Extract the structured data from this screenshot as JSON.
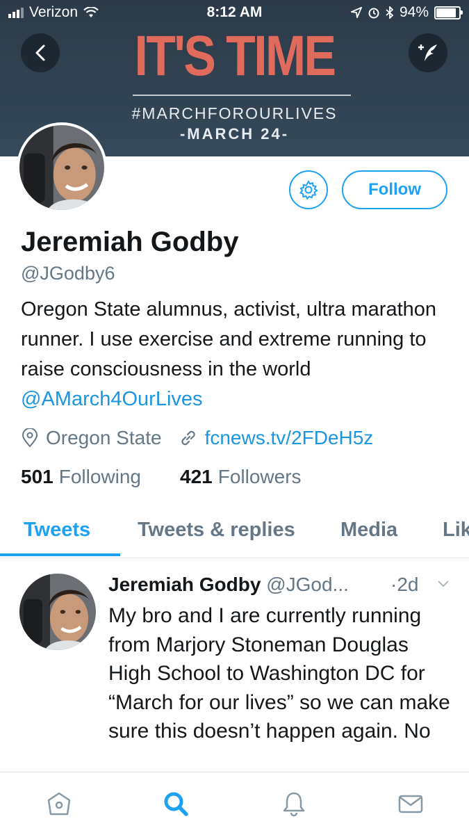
{
  "status_bar": {
    "carrier": "Verizon",
    "time": "8:12 AM",
    "battery": "94%"
  },
  "banner": {
    "headline": "IT'S TIME",
    "hashtag": "#MARCHFOROURLIVES",
    "date": "-MARCH 24-"
  },
  "profile": {
    "follow_label": "Follow",
    "name": "Jeremiah Godby",
    "handle": "@JGodby6",
    "bio_text": "Oregon State alumnus, activist, ultra marathon runner. I use exercise and extreme running to raise consciousness in the world",
    "bio_mention": "@AMarch4OurLives",
    "location": "Oregon State",
    "link": "fcnews.tv/2FDeH5z",
    "following_count": "501",
    "following_label": "Following",
    "followers_count": "421",
    "followers_label": "Followers"
  },
  "tabs": [
    {
      "label": "Tweets",
      "active": true
    },
    {
      "label": "Tweets & replies",
      "active": false
    },
    {
      "label": "Media",
      "active": false
    },
    {
      "label": "Lik",
      "active": false
    }
  ],
  "tweet": {
    "name": "Jeremiah Godby",
    "handle": "@JGod...",
    "time": "·2d",
    "body": "My bro and I are currently running from Marjory Stoneman Douglas High School to Washington DC for “March for our lives” so we can make sure this doesn’t happen again. No"
  },
  "icons": {
    "back": "back-arrow-icon",
    "compose": "compose-tweet-icon",
    "settings": "gear-icon",
    "location": "location-pin-icon",
    "link": "link-icon",
    "caret": "chevron-down-icon",
    "nav": [
      "home-icon",
      "search-icon",
      "notifications-bell-icon",
      "messages-envelope-icon"
    ]
  },
  "colors": {
    "accent": "#1da1f2",
    "link": "#1b95e0",
    "banner_bg": "#2c3a48",
    "headline": "#e06a5c",
    "muted": "#657786"
  }
}
